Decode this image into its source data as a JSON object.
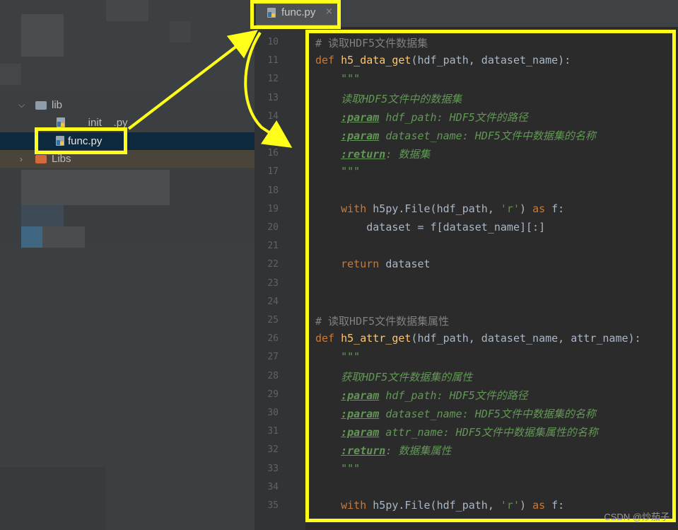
{
  "project_tree": {
    "items": [
      {
        "label": "lib",
        "type": "folder",
        "expanded": true
      },
      {
        "label": "__init__.py",
        "type": "python-file"
      },
      {
        "label": "func.py",
        "type": "python-file",
        "selected": true
      },
      {
        "label": "Libs",
        "type": "folder",
        "expanded": false
      }
    ]
  },
  "tab": {
    "label": "func.py",
    "close": "×"
  },
  "editor": {
    "lines": [
      {
        "n": "10",
        "text": "# 读取HDF5文件数据集"
      },
      {
        "n": "11",
        "text": "def h5_data_get(hdf_path, dataset_name):"
      },
      {
        "n": "12",
        "text": "    \"\"\""
      },
      {
        "n": "13",
        "text": "    读取HDF5文件中的数据集"
      },
      {
        "n": "14",
        "text": "    :param hdf_path: HDF5文件的路径"
      },
      {
        "n": "15",
        "text": "    :param dataset_name: HDF5文件中数据集的名称"
      },
      {
        "n": "16",
        "text": "    :return: 数据集"
      },
      {
        "n": "17",
        "text": "    \"\"\""
      },
      {
        "n": "18",
        "text": ""
      },
      {
        "n": "19",
        "text": "    with h5py.File(hdf_path, 'r') as f:"
      },
      {
        "n": "20",
        "text": "        dataset = f[dataset_name][:]"
      },
      {
        "n": "21",
        "text": ""
      },
      {
        "n": "22",
        "text": "    return dataset"
      },
      {
        "n": "23",
        "text": ""
      },
      {
        "n": "24",
        "text": ""
      },
      {
        "n": "25",
        "text": "# 读取HDF5文件数据集属性"
      },
      {
        "n": "26",
        "text": "def h5_attr_get(hdf_path, dataset_name, attr_name):"
      },
      {
        "n": "27",
        "text": "    \"\"\""
      },
      {
        "n": "28",
        "text": "    获取HDF5文件数据集的属性"
      },
      {
        "n": "29",
        "text": "    :param hdf_path: HDF5文件的路径"
      },
      {
        "n": "30",
        "text": "    :param dataset_name: HDF5文件中数据集的名称"
      },
      {
        "n": "31",
        "text": "    :param attr_name: HDF5文件中数据集属性的名称"
      },
      {
        "n": "32",
        "text": "    :return: 数据集属性"
      },
      {
        "n": "33",
        "text": "    \"\"\""
      },
      {
        "n": "34",
        "text": ""
      },
      {
        "n": "35",
        "text": "    with h5py.File(hdf_path, 'r') as f:"
      }
    ]
  },
  "watermark": "CSDN @炒茄子",
  "colors": {
    "annotation": "#ffff1a",
    "selection": "#0d293e",
    "accent": "#4a88c7"
  },
  "icons": [
    "python-file-icon",
    "folder-icon",
    "chevron-right-icon",
    "chevron-down-icon",
    "close-icon"
  ]
}
